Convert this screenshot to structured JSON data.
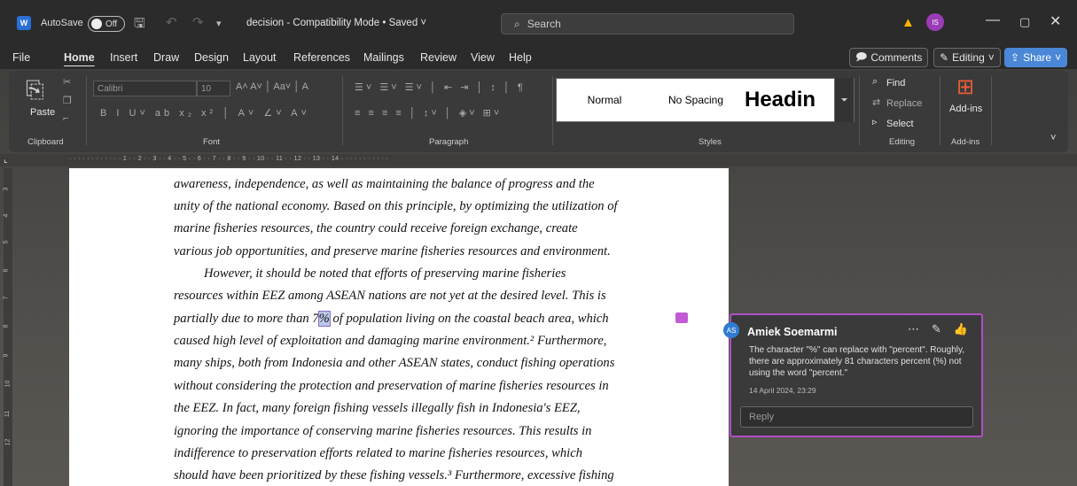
{
  "titlebar": {
    "logo": "W",
    "autosave_label": "AutoSave",
    "autosave_state": "Off",
    "doc_title": "decision  -  Compatibility Mode • Saved ˅",
    "search_placeholder": "Search",
    "user_initials": "IS"
  },
  "menu": {
    "items": [
      "File",
      "Home",
      "Insert",
      "Draw",
      "Design",
      "Layout",
      "References",
      "Mailings",
      "Review",
      "View",
      "Help"
    ],
    "comments_label": "Comments",
    "editing_label": "Editing",
    "share_label": "Share"
  },
  "ribbon": {
    "paste_label": "Paste",
    "clipboard_label": "Clipboard",
    "font_name": "Calibri",
    "font_size": "10",
    "font_label": "Font",
    "paragraph_label": "Paragraph",
    "styles": [
      "Normal",
      "No Spacing",
      "Headin"
    ],
    "styles_label": "Styles",
    "find_label": "Find",
    "replace_label": "Replace",
    "select_label": "Select",
    "editing_group_label": "Editing",
    "addins_label": "Add-ins",
    "addins_group_label": "Add-ins"
  },
  "ruler": {
    "text": "·  ·  ·  ·  ·  ·  ·  ·  ·  ·  ·  ·  1  ·  ·  2  ·  ·  3  ·  ·  4  ·  ·  5  ·  ·  6  ·  ·  7  ·  ·  8  ·  ·  9  ·  ·  10  ·  ·  11  ·  ·  12  ·  ·  13  ·  ·  14  ·  ·  ·  ·  ·  ·  ·  ·  ·  ·  ·",
    "vertical": [
      "3",
      "4",
      "5",
      "6",
      "7",
      "8",
      "9",
      "10",
      "11",
      "12"
    ]
  },
  "document": {
    "lines": [
      "awareness, independence, as well as maintaining the balance of progress and the",
      "unity of the national economy. Based on this principle, by optimizing the utilization of",
      "marine fisheries resources, the country could receive foreign exchange, create",
      "various job opportunities, and preserve marine fisheries resources and environment.",
      "However, it should be noted that efforts of preserving marine fisheries",
      "resources within EEZ among ASEAN nations are not yet at the desired level. This is",
      "caused high level of exploitation and damaging marine environment.² Furthermore,",
      "many ships, both from Indonesia and other ASEAN states, conduct fishing operations",
      "without considering the protection and preservation of marine fisheries resources in",
      "the EEZ. In fact, many foreign fishing vessels illegally fish in Indonesia's EEZ,",
      "ignoring the importance of conserving marine fisheries resources. This results in",
      "indifference to preservation efforts related to marine fisheries resources, which",
      "should have been prioritized by these fishing vessels.³ Furthermore, excessive fishing"
    ],
    "highlight_line_before": "partially due to more than 7",
    "highlight_text": "%",
    "highlight_line_after": " of population living on the coastal beach area, which"
  },
  "comment": {
    "initials": "AS",
    "author": "Amiek Soemarmi",
    "body": "The character \"%\" can replace with \"percent\". Roughly, there are approximately 81 characters percent (%) not using the word \"percent.\"",
    "date": "14 April 2024, 23:29",
    "reply_placeholder": "Reply"
  }
}
